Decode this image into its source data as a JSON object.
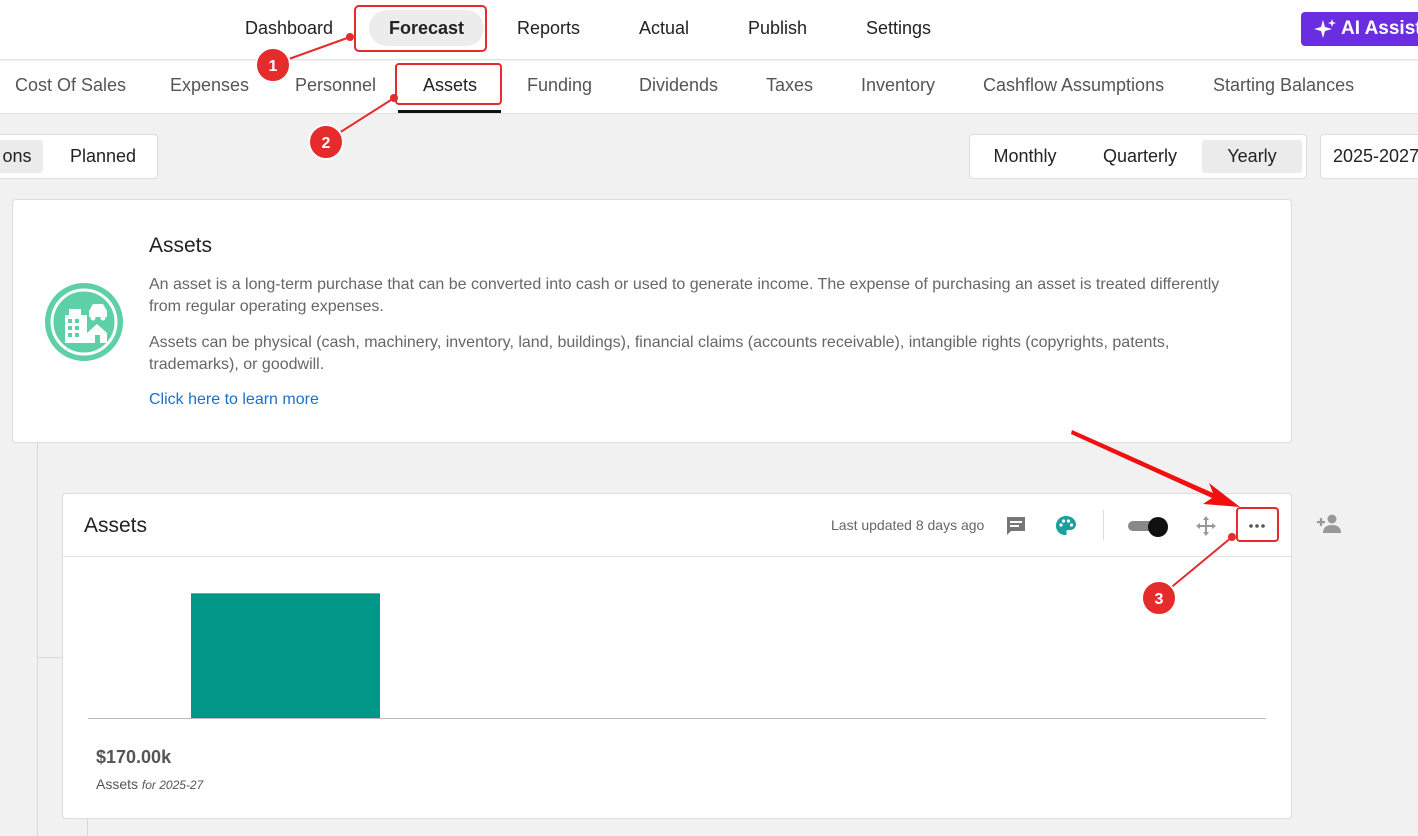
{
  "topnav": {
    "items": [
      "Dashboard",
      "Forecast",
      "Reports",
      "Actual",
      "Publish",
      "Settings"
    ],
    "active": "Forecast",
    "ai_label": "AI Assist"
  },
  "subnav": {
    "tabs": [
      "Cost Of Sales",
      "Expenses",
      "Personnel",
      "Assets",
      "Funding",
      "Dividends",
      "Taxes",
      "Inventory",
      "Cashflow Assumptions",
      "Starting Balances"
    ],
    "active": "Assets"
  },
  "toolbar": {
    "view_left": "ons",
    "view_right": "Planned",
    "periods": [
      "Monthly",
      "Quarterly",
      "Yearly"
    ],
    "period_selected": "Yearly",
    "year_range": "2025-2027"
  },
  "intro": {
    "icon": "buildings-car-house-icon",
    "title": "Assets",
    "para1": "An asset is a long-term purchase that can be converted into cash or used to generate income. The expense of purchasing an asset is treated differently from regular operating expenses.",
    "para2": "Assets can be physical (cash, machinery, inventory, land, buildings), financial claims (accounts receivable), intangible rights (copyrights, patents, trademarks), or goodwill.",
    "link": "Click here to learn more"
  },
  "card": {
    "title": "Assets",
    "updated": "Last updated 8 days ago",
    "icons": [
      "comment-icon",
      "palette-icon",
      "toggle",
      "move-icon",
      "more-options-icon",
      "add-user-icon"
    ],
    "total": "$170.00k",
    "sublabel": "Assets",
    "subperiod": "for 2025-27"
  },
  "chart_data": {
    "type": "bar",
    "categories": [
      "2025-27"
    ],
    "values": [
      170000
    ],
    "ylim": [
      0,
      210000
    ],
    "grid": false,
    "bar_color": "#009688"
  },
  "annotations": {
    "labels": [
      "1",
      "2",
      "3"
    ],
    "color": "#e52b2b"
  },
  "colors": {
    "accent_purple": "#6a2ee0",
    "teal": "#009688",
    "icon_green": "#5ed0a6",
    "link_blue": "#1a6fd0"
  }
}
